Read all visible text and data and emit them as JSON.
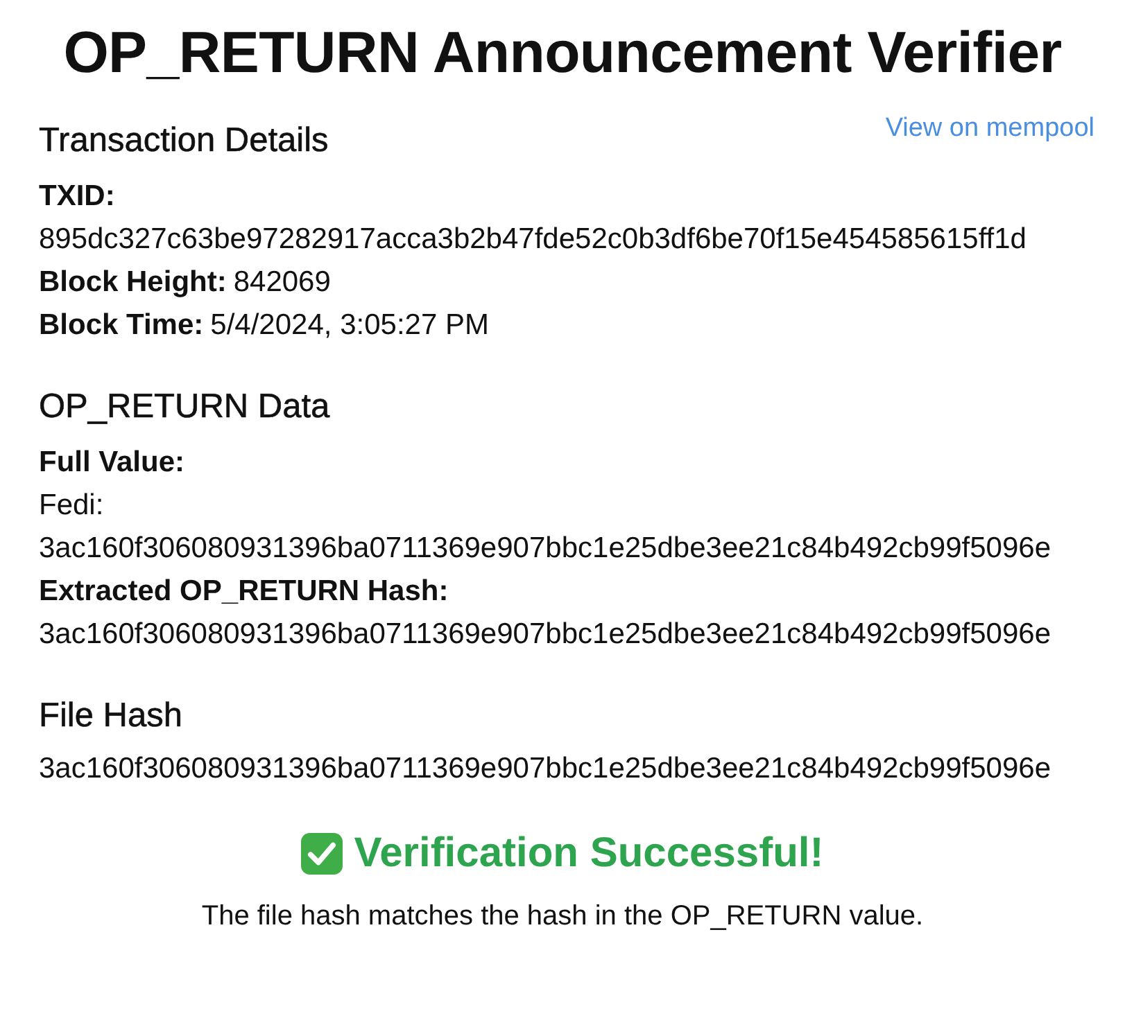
{
  "title": "OP_RETURN Announcement Verifier",
  "sections": [
    {
      "heading": "Transaction Details",
      "link": "View on mempool",
      "fields": [
        {
          "label": "TXID:",
          "value": "895dc327c63be97282917acca3b2b47fde52c0b3df6be70f15e454585615ff1d",
          "kind": "block"
        },
        {
          "label": "Block Height:",
          "value": "842069",
          "kind": "inline"
        },
        {
          "label": "Block Time:",
          "value": "5/4/2024, 3:05:27 PM",
          "kind": "inline"
        }
      ]
    },
    {
      "heading": "OP_RETURN Data",
      "fields": [
        {
          "label": "Full Value:",
          "value": "Fedi: 3ac160f306080931396ba0711369e907bbc1e25dbe3ee21c84b492cb99f5096e",
          "kind": "block"
        },
        {
          "label": "Extracted OP_RETURN Hash:",
          "value": "3ac160f306080931396ba0711369e907bbc1e25dbe3ee21c84b492cb99f5096e",
          "kind": "block"
        }
      ]
    },
    {
      "heading": "File Hash",
      "text": "3ac160f306080931396ba0711369e907bbc1e25dbe3ee21c84b492cb99f5096e"
    }
  ],
  "result": {
    "success": true,
    "heading": "Verification Successful!",
    "message": "The file hash matches the hash in the OP_RETURN value."
  }
}
